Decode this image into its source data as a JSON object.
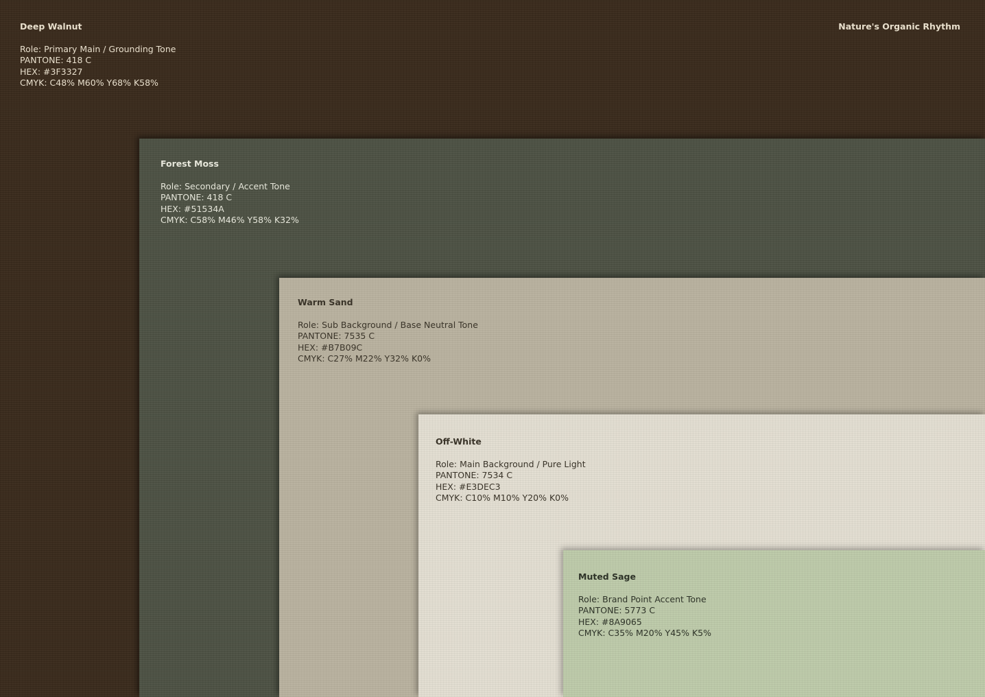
{
  "brand": "Nature's Organic Rhythm",
  "swatches": [
    {
      "name": "Deep Walnut",
      "role": "Role: Primary Main / Grounding Tone",
      "pantone": "PANTONE: 418 C",
      "hex": "HEX: #3F3327",
      "cmyk": "CMYK: C48% M60% Y68% K58%",
      "color": "#3a2a1c"
    },
    {
      "name": "Forest Moss",
      "role": "Role: Secondary / Accent Tone",
      "pantone": "PANTONE: 418 C",
      "hex": "HEX: #51534A",
      "cmyk": "CMYK: C58% M46% Y58% K32%",
      "color": "#4d5244"
    },
    {
      "name": "Warm Sand",
      "role": "Role: Sub Background / Base Neutral Tone",
      "pantone": "PANTONE: 7535 C",
      "hex": "HEX: #B7B09C",
      "cmyk": "CMYK: C27% M22% Y32% K0%",
      "color": "#b9b29f"
    },
    {
      "name": "Off-White",
      "role": "Role: Main Background / Pure Light",
      "pantone": "PANTONE: 7534 C",
      "hex": "HEX: #E3DEC3",
      "cmyk": "CMYK: C10% M10% Y20% K0%",
      "color": "#e2ddd1"
    },
    {
      "name": "Muted Sage",
      "role": "Role: Brand Point Accent Tone",
      "pantone": "PANTONE: 5773 C",
      "hex": "HEX: #8A9065",
      "cmyk": "CMYK: C35% M20% Y45% K5%",
      "color": "#bdcaaa"
    }
  ]
}
